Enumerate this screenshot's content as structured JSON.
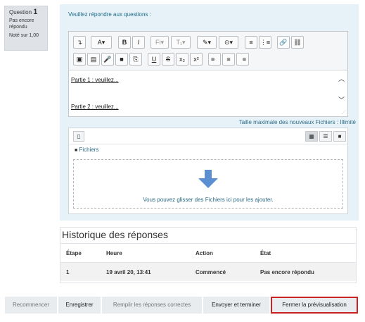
{
  "question_info": {
    "label": "Question",
    "number": "1",
    "status_line1": "Pas encore",
    "status_line2": "répondu",
    "grade": "Noté sur 1,00"
  },
  "prompt": "Veuillez répondre aux questions :",
  "editor": {
    "toolbar_row1": [
      "↴",
      "A▾",
      "B",
      "I",
      "Fi▾",
      "T₁▾",
      "✎▾",
      "⊙▾",
      "≡",
      "⋮≡",
      "🔗",
      "⛓"
    ],
    "toolbar_row2": [
      "▣",
      "▤",
      "🎤",
      "■",
      "⎘",
      "U",
      "S",
      "x₂",
      "x²",
      "≡",
      "≡",
      "≡"
    ],
    "content_line1": "Partie 1 : veuillez...",
    "content_line2": "Partie 2 : veuillez..."
  },
  "max_size_label": "Taille maximale des nouveaux Fichiers : Illimité",
  "file_manager": {
    "path_label": "Fichiers",
    "drop_text": "Vous pouvez glisser des Fichiers ici pour les ajouter."
  },
  "history": {
    "title": "Historique des réponses",
    "columns": [
      "Étape",
      "Heure",
      "Action",
      "État"
    ],
    "rows": [
      {
        "step": "1",
        "time": "19 avril 20, 13:41",
        "action": "Commencé",
        "state": "Pas encore répondu"
      }
    ]
  },
  "buttons": {
    "restart": "Recommencer",
    "save": "Enregistrer",
    "fill_correct": "Remplir les réponses correctes",
    "submit": "Envoyer et terminer",
    "close_preview": "Fermer la prévisualisation"
  },
  "colors": {
    "highlight": "#cc2222",
    "formulation_bg": "#e6f2f8",
    "link": "#2e6b85",
    "drop_arrow": "#5b8fd1"
  }
}
